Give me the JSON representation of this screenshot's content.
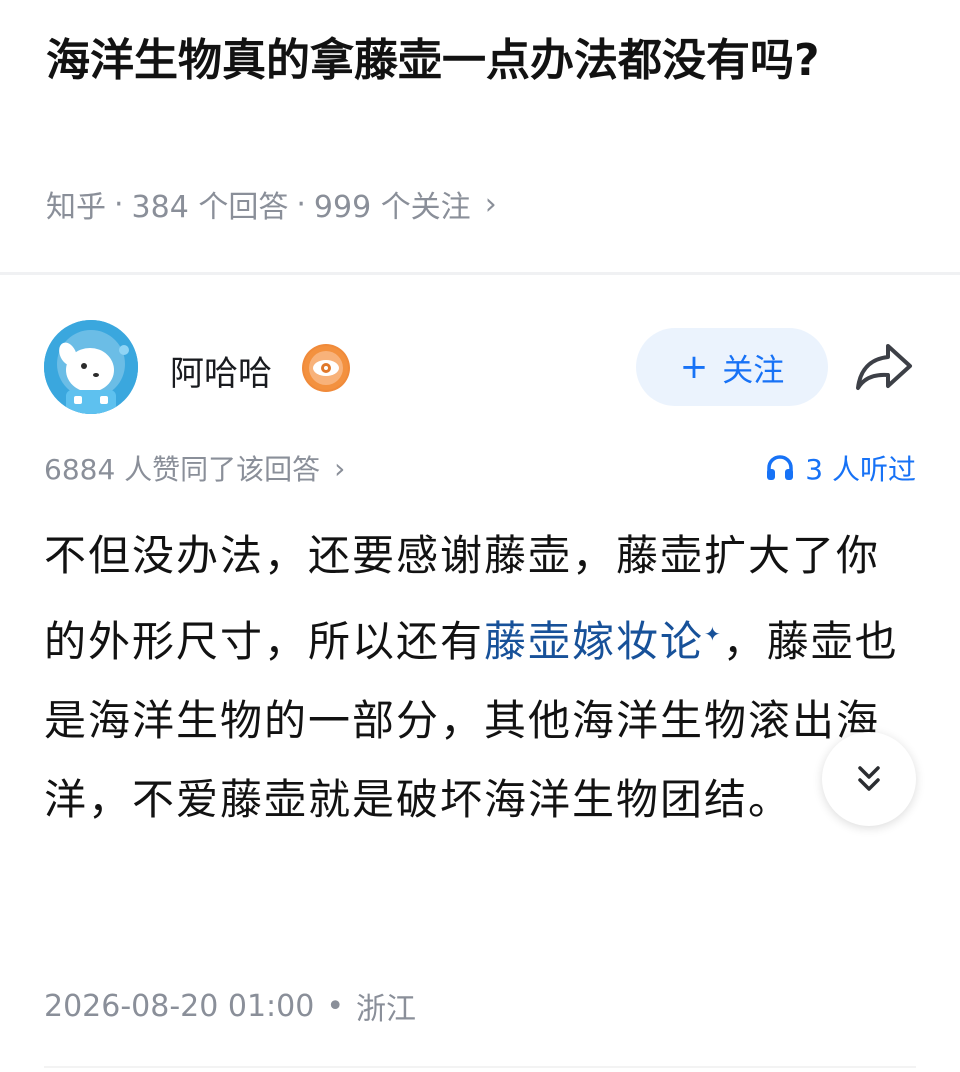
{
  "question": {
    "title": "海洋生物真的拿藤壶一点办法都没有吗?",
    "source": "知乎",
    "separator": "·",
    "answers": "384 个回答",
    "followers": "999 个关注",
    "chevron": "›"
  },
  "author": {
    "name": "阿哈哈",
    "follow_plus": "+",
    "follow_label": "关注",
    "avatar_icon": "astronaut-dog-avatar",
    "badge_icon": "eye-badge-icon",
    "share_icon": "share-arrow-icon"
  },
  "stats": {
    "agree_text": "6884 人赞同了该回答",
    "agree_chevron": "›",
    "listen_text": "3 人听过",
    "listen_icon": "headphones-icon"
  },
  "answer": {
    "part1": "不但没办法，还要感谢藤壶，藤壶扩大了你的外形尺寸，所以还有",
    "link_text": "藤壶嫁妆论",
    "link_mark": "✦",
    "part2": "，藤壶也是海洋生物的一部分，其他海洋生物滚出海洋，不爱藤壶就是破坏海洋生物团结。"
  },
  "footer": {
    "date": "2026-08-20 01:00",
    "separator": "•",
    "location": "浙江"
  },
  "controls": {
    "expand_icon": "double-chevron-down-icon"
  },
  "colors": {
    "accent": "#1772f6",
    "link": "#175199",
    "muted": "#8a8f99",
    "follow_bg": "#ebf3fd"
  }
}
